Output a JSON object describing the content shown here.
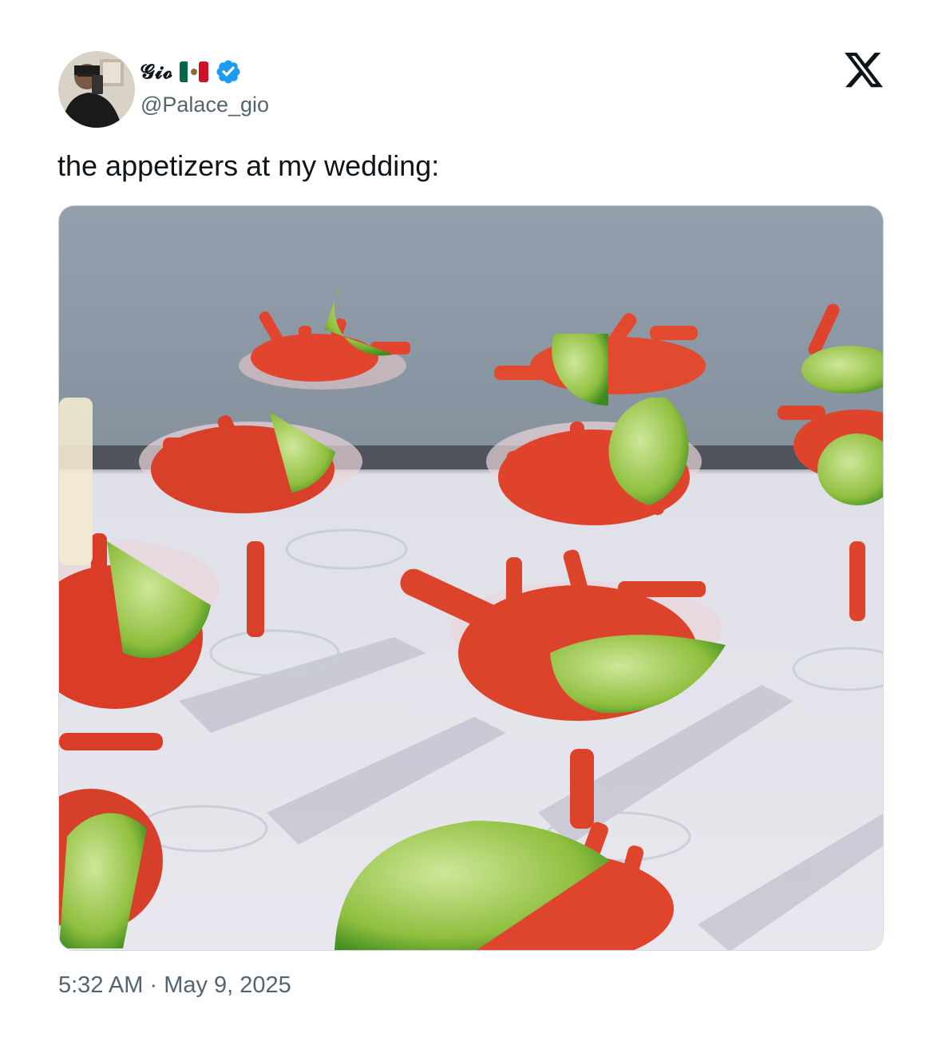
{
  "author": {
    "display_name": "𝓖𝓲𝓸",
    "handle": "@Palace_gio",
    "flag_icon": "mexico-flag-icon",
    "verified_icon": "verified-badge-icon",
    "verified_color": "#1d9bf0"
  },
  "brand_icon": "x-logo-icon",
  "tweet": {
    "text": "the appetizers at my wedding:",
    "time": "5:32 AM",
    "separator": " · ",
    "date": "May 9, 2025"
  },
  "colors": {
    "text": "#0f1419",
    "secondary": "#536471",
    "border": "#cfd9de"
  }
}
